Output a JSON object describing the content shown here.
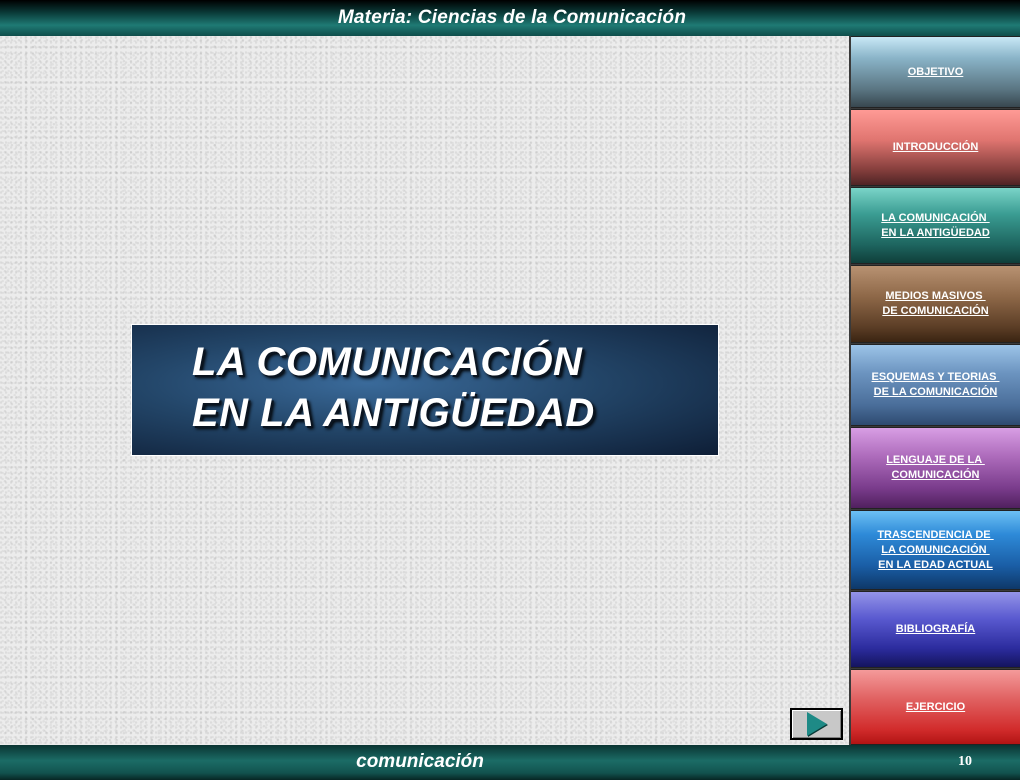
{
  "header": {
    "title": "Materia: Ciencias de la Comunicación"
  },
  "slide": {
    "title_line1": "LA COMUNICACIÓN",
    "title_line2": "EN LA ANTIGÜEDAD"
  },
  "nav": {
    "items": [
      {
        "label": "OBJETIVO"
      },
      {
        "label": "INTRODUCCIÓN"
      },
      {
        "label": "LA COMUNICACIÓN \nEN LA ANTIGÜEDAD"
      },
      {
        "label": "MEDIOS MASIVOS \nDE COMUNICACIÓN"
      },
      {
        "label": "ESQUEMAS Y TEORIAS \nDE LA COMUNICACIÓN"
      },
      {
        "label": "LENGUAJE DE LA \nCOMUNICACIÓN"
      },
      {
        "label": "TRASCENDENCIA DE \nLA COMUNICACIÓN \nEN LA EDAD ACTUAL"
      },
      {
        "label": "BIBLIOGRAFÍA"
      },
      {
        "label": "EJERCICIO"
      }
    ]
  },
  "controls": {
    "next_icon": "play-arrow-icon",
    "accent": "#1e8a86"
  },
  "footer": {
    "title": "comunicación",
    "page_number": "10"
  }
}
